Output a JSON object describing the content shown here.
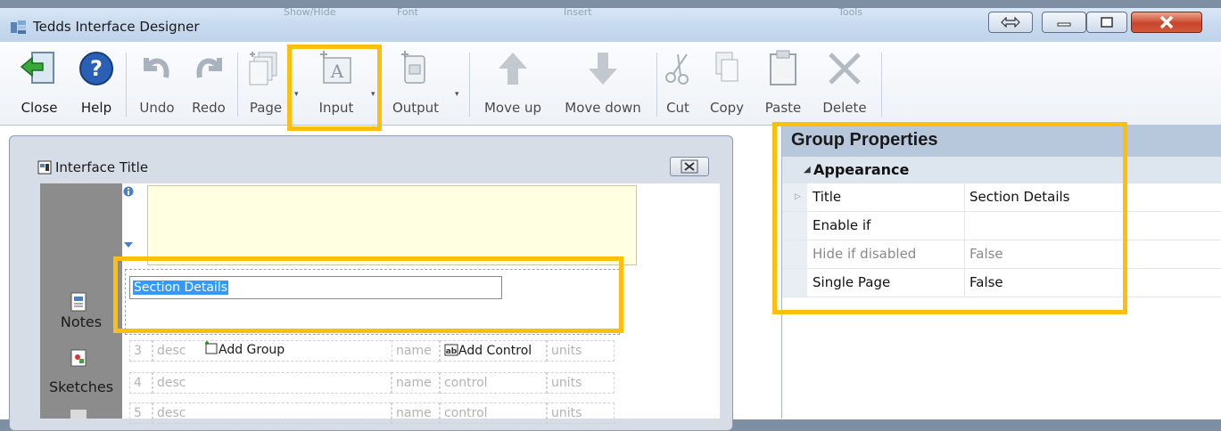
{
  "window": {
    "title": "Tedds Interface Designer"
  },
  "ghost_tabs": [
    "Show/Hide",
    "Font",
    "Insert",
    "Tools"
  ],
  "toolbar": {
    "close": "Close",
    "help": "Help",
    "undo": "Undo",
    "redo": "Redo",
    "page": "Page",
    "input": "Input",
    "output": "Output",
    "move_up": "Move up",
    "move_down": "Move down",
    "cut": "Cut",
    "copy": "Copy",
    "paste": "Paste",
    "delete": "Delete"
  },
  "interface_panel": {
    "title": "Interface Title",
    "section_value": "Section Details",
    "sidebar": {
      "notes": "Notes",
      "sketches": "Sketches"
    },
    "rows": [
      {
        "num": "3",
        "desc": "desc",
        "add_group": "Add Group",
        "name": "name",
        "add_control": "Add Control",
        "units": "units"
      },
      {
        "num": "4",
        "desc": "desc",
        "name": "name",
        "control": "control",
        "units": "units"
      },
      {
        "num": "5",
        "desc": "desc",
        "name": "name",
        "control": "control",
        "units": "units"
      }
    ]
  },
  "group_properties": {
    "title": "Group Properties",
    "category": "Appearance",
    "rows": [
      {
        "name": "Title",
        "value": "Section Details",
        "disabled": false
      },
      {
        "name": "Enable if",
        "value": "",
        "disabled": false
      },
      {
        "name": "Hide if disabled",
        "value": "False",
        "disabled": true
      },
      {
        "name": "Single Page",
        "value": "False",
        "disabled": false
      }
    ]
  },
  "colors": {
    "highlight": "#fcbf0e",
    "selection": "#3399ff",
    "note_bg": "#ffffe1"
  }
}
